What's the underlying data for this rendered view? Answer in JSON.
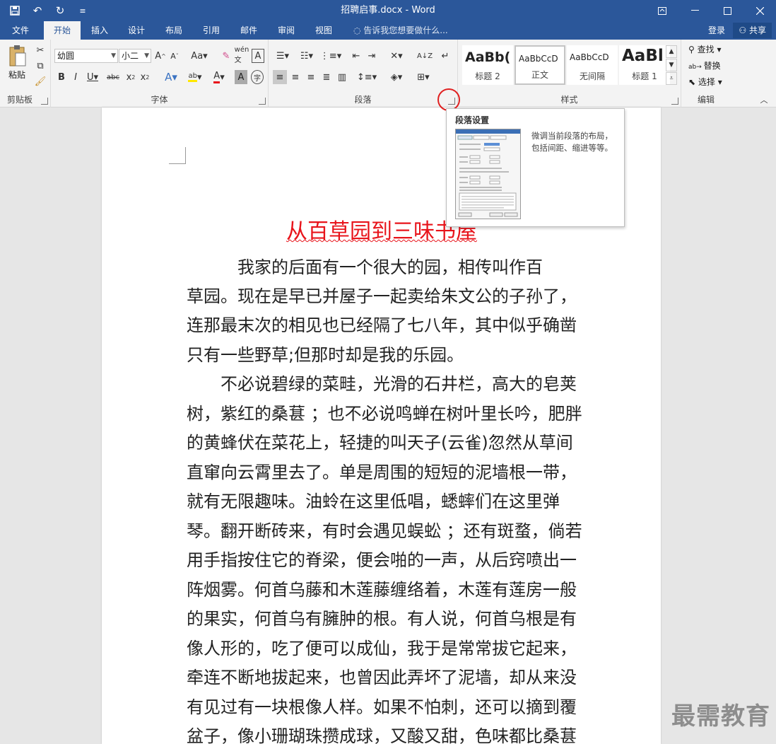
{
  "window": {
    "title": "招聘启事.docx - Word",
    "qat_icons": [
      "save-icon",
      "undo-icon",
      "redo-icon",
      "customize-icon"
    ]
  },
  "tabs": [
    {
      "label": "文件"
    },
    {
      "label": "开始"
    },
    {
      "label": "插入"
    },
    {
      "label": "设计"
    },
    {
      "label": "布局"
    },
    {
      "label": "引用"
    },
    {
      "label": "邮件"
    },
    {
      "label": "审阅"
    },
    {
      "label": "视图"
    }
  ],
  "tell_me": "告诉我您想要做什么...",
  "account": {
    "login": "登录",
    "share": "共享"
  },
  "ribbon": {
    "clipboard": {
      "label": "剪贴板",
      "paste": "粘贴"
    },
    "font": {
      "label": "字体",
      "font_name": "幼圆",
      "font_size": "小二"
    },
    "paragraph": {
      "label": "段落"
    },
    "styles": {
      "label": "样式",
      "items": [
        {
          "preview": "AaBb(",
          "name": "标题 2"
        },
        {
          "preview": "AaBbCcD",
          "name": "正文"
        },
        {
          "preview": "AaBbCcD",
          "name": "无间隔"
        },
        {
          "preview": "AaBl",
          "name": "标题 1"
        }
      ]
    },
    "editing": {
      "label": "编辑",
      "find": "查找",
      "replace": "替换",
      "select": "选择"
    }
  },
  "tooltip": {
    "title": "段落设置",
    "description": "微调当前段落的布局，包括间距、缩进等等。"
  },
  "document": {
    "heading": "从百草园到三味书屋",
    "lines": [
      "　　　我家的后面有一个很大的园，相传叫作百",
      "草园。现在是早已并屋子一起卖给朱文公的子孙了，",
      "连那最末次的相见也已经隔了七八年，其中似乎确凿",
      "只有一些野草;但那时却是我的乐园。",
      "　　不必说碧绿的菜畦，光滑的石井栏，高大的皂荚",
      "树，紫红的桑葚 ；也不必说鸣蝉在树叶里长吟，肥胖",
      "的黄蜂伏在菜花上，轻捷的叫天子(云雀)忽然从草间",
      "直窜向云霄里去了。单是周围的短短的泥墙根一带，",
      "就有无限趣味。油蛉在这里低唱，蟋蟀们在这里弹",
      "琴。翻开断砖来，有时会遇见蜈蚣 ；还有斑蝥，倘若",
      "用手指按住它的脊梁，便会啪的一声，从后窍喷出一",
      "阵烟雾。何首乌藤和木莲藤缠络着，木莲有莲房一般",
      "的果实，何首乌有臃肿的根。有人说，何首乌根是有",
      "像人形的，吃了便可以成仙，我于是常常拔它起来，",
      "牵连不断地拔起来，也曾因此弄坏了泥墙，却从来没",
      "有见过有一块根像人样。如果不怕刺，还可以摘到覆",
      "盆子，像小珊瑚珠攒成球，又酸又甜，色味都比桑葚"
    ]
  },
  "watermark": "最需教育"
}
